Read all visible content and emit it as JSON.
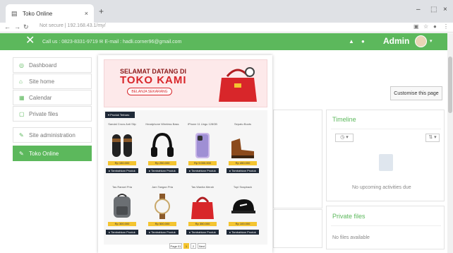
{
  "browser": {
    "tab_title": "Toko Online",
    "tab_close": "×",
    "new_tab": "+",
    "min": "–",
    "max": "⬚",
    "close": "×",
    "url": "Not secure | 192.168.43.1/my/"
  },
  "header": {
    "close_glyph": "✕",
    "contact": "Call us : 0823-8331-9719 ✉ E-mail : hadli.corner96@gmail.com",
    "user_name": "Admin"
  },
  "sidebar": {
    "items": [
      {
        "label": "Dashboard",
        "icon": "◎"
      },
      {
        "label": "Site home",
        "icon": "⌂"
      },
      {
        "label": "Calendar",
        "icon": "▦"
      },
      {
        "label": "Private files",
        "icon": "▢"
      },
      {
        "label": "Site administration",
        "icon": "✎"
      },
      {
        "label": "Toko Online",
        "icon": "✎"
      }
    ]
  },
  "main": {
    "customise_label": "Customise this page",
    "timeline_title": "Timeline",
    "timeline_empty": "No upcoming activities due",
    "private_files_title": "Private files",
    "private_files_empty": "No files available"
  },
  "promo": {
    "line1": "SELAMAT DATANG DI",
    "line2": "TOKO KAMI",
    "cta": "BELANJA SEKARANG",
    "category_label": "▾ Produk Terbaru",
    "products": [
      {
        "name": "Sandal Crocs Anti Slip",
        "price": "Rp 150.000",
        "buy": "▸ Tambahkan Produk"
      },
      {
        "name": "Headphone Wireless Bass",
        "price": "Rp 250.000",
        "buy": "▸ Tambahkan Produk"
      },
      {
        "name": "iPhone 11 Ungu 128GB",
        "price": "Rp 9.000.000",
        "buy": "▸ Tambahkan Produk"
      },
      {
        "name": "Sepatu Boots",
        "price": "Rp 450.000",
        "buy": "▸ Tambahkan Produk"
      },
      {
        "name": "Tas Ransel Pria",
        "price": "Rp 300.000",
        "buy": "▸ Tambahkan Produk"
      },
      {
        "name": "Jam Tangan Pria",
        "price": "Rp 500.000",
        "buy": "▸ Tambahkan Produk"
      },
      {
        "name": "Tas Wanita Merah",
        "price": "Rp 350.000",
        "buy": "▸ Tambahkan Produk"
      },
      {
        "name": "Topi Snapback",
        "price": "Rp 100.000",
        "buy": "▸ Tambahkan Produk"
      }
    ],
    "pager_prev": "Page 01",
    "pager_current": "1",
    "pager_next": "2",
    "pager_last": "Next"
  },
  "colors": {
    "accent": "#5cb85c",
    "banner_red": "#d8262a",
    "dark": "#1f2937",
    "price": "#f4c430"
  }
}
